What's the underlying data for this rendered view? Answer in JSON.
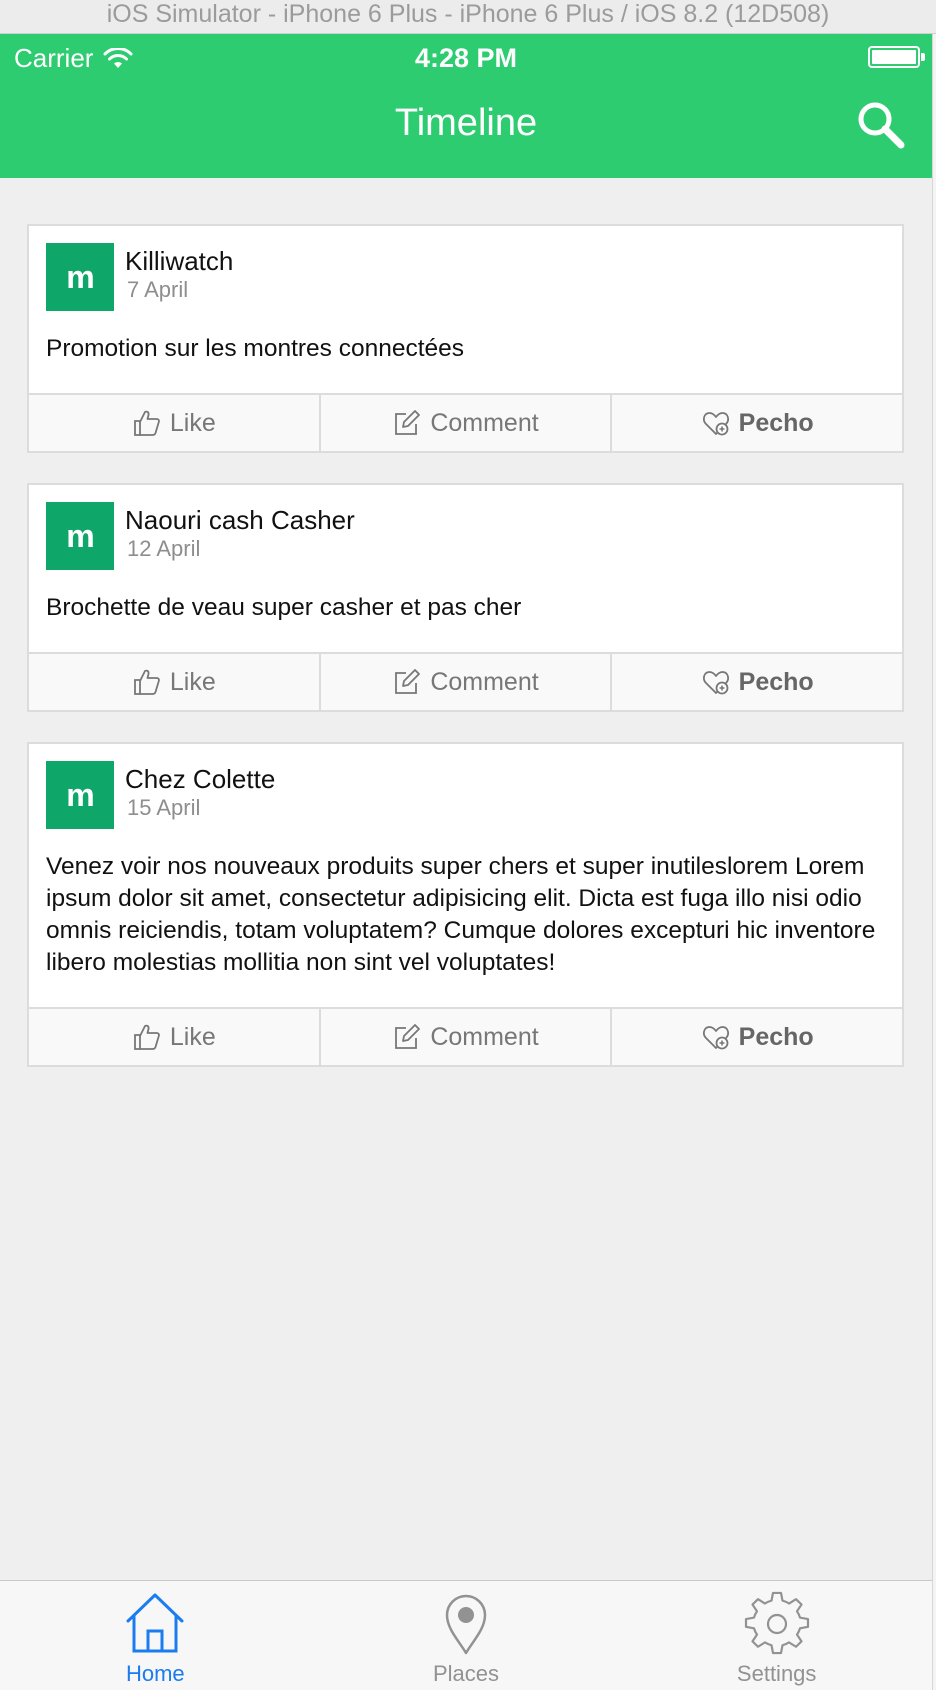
{
  "window": {
    "title": "iOS Simulator - iPhone 6 Plus - iPhone 6 Plus / iOS 8.2 (12D508)"
  },
  "status_bar": {
    "carrier": "Carrier",
    "time": "4:28 PM"
  },
  "nav": {
    "title": "Timeline",
    "search_icon": "search-icon"
  },
  "colors": {
    "header": "#2ecc71",
    "avatar": "#0fa66a",
    "tab_active": "#1b7cf0"
  },
  "posts": [
    {
      "avatar_letter": "m",
      "author": "Killiwatch",
      "date": "7 April",
      "text": "Promotion sur les montres connectées"
    },
    {
      "avatar_letter": "m",
      "author": "Naouri cash Casher",
      "date": "12 April",
      "text": "Brochette de veau super casher et pas cher"
    },
    {
      "avatar_letter": "m",
      "author": "Chez Colette",
      "date": "15 April",
      "text": "Venez voir nos nouveaux produits super chers et super inutileslorem Lorem ipsum dolor sit amet, consectetur adipisicing elit. Dicta est fuga illo nisi odio omnis reiciendis, totam voluptatem? Cumque dolores excepturi hic inventore libero molestias mollitia non sint vel voluptates!"
    }
  ],
  "actions": {
    "like": "Like",
    "comment": "Comment",
    "pecho": "Pecho"
  },
  "tabs": [
    {
      "label": "Home",
      "icon": "home-icon",
      "active": true
    },
    {
      "label": "Places",
      "icon": "map-pin-icon",
      "active": false
    },
    {
      "label": "Settings",
      "icon": "gear-icon",
      "active": false
    }
  ]
}
